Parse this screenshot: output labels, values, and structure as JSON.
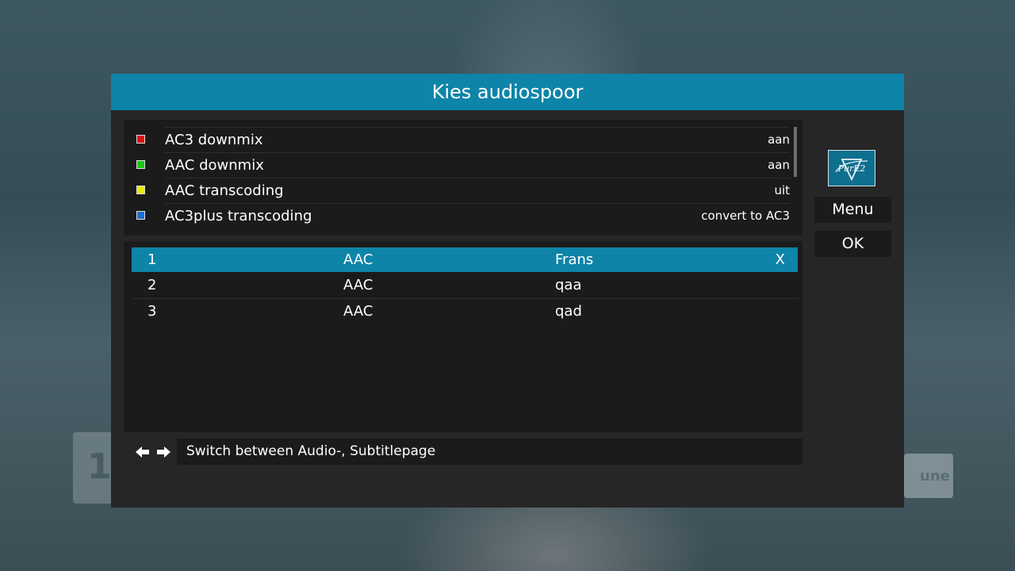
{
  "dialog": {
    "title": "Kies audiospoor"
  },
  "settings": [
    {
      "label": "AC3 downmix",
      "value": "aan",
      "color": "#e01010"
    },
    {
      "label": "AAC downmix",
      "value": "aan",
      "color": "#18c818"
    },
    {
      "label": "AAC transcoding",
      "value": "uit",
      "color": "#e8e800"
    },
    {
      "label": "AC3plus transcoding",
      "value": "convert to AC3",
      "color": "#1a6fd6"
    }
  ],
  "tracks": [
    {
      "number": "1",
      "codec": "AAC",
      "language": "Frans",
      "active": "X"
    },
    {
      "number": "2",
      "codec": "AAC",
      "language": "qaa",
      "active": ""
    },
    {
      "number": "3",
      "codec": "AAC",
      "language": "qad",
      "active": ""
    }
  ],
  "side": {
    "logo_text": "PurE2",
    "menu_label": "Menu",
    "ok_label": "OK"
  },
  "footer": {
    "hint": "Switch between Audio-, Subtitlepage",
    "arrow_icons": [
      "arrow-left-icon",
      "arrow-right-icon"
    ]
  },
  "background": {
    "left_channel_text": "1",
    "right_channel_text": "une"
  },
  "colors": {
    "accent": "#0e84a8",
    "dialog_bg": "#262626",
    "panel_bg": "#1b1b1b"
  }
}
